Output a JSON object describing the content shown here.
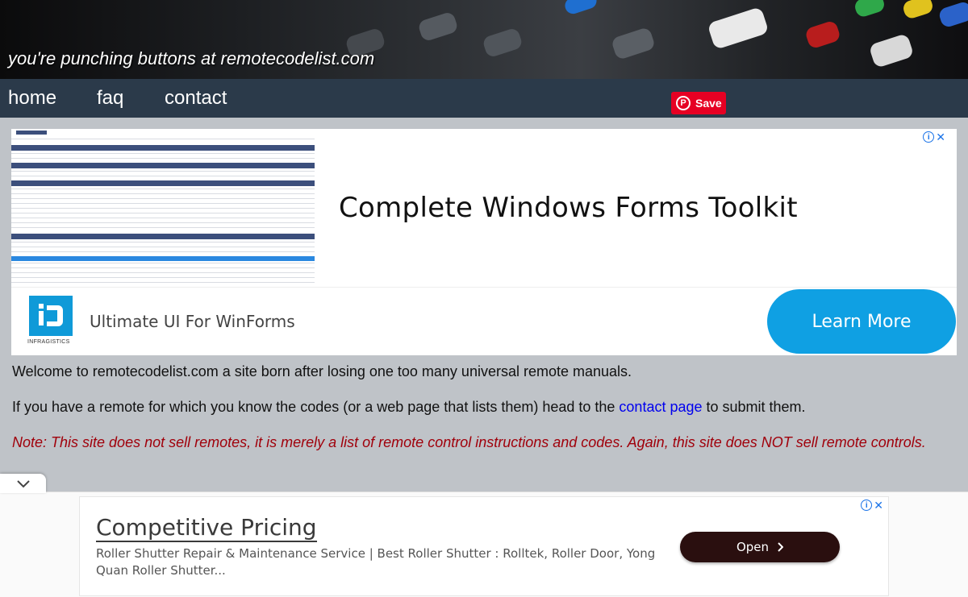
{
  "header": {
    "tagline": "you're punching buttons at remotecodelist.com"
  },
  "nav": {
    "items": [
      "home",
      "faq",
      "contact"
    ]
  },
  "pinterest": {
    "label": "Save",
    "color": "#e60023",
    "icon": "pinterest-icon"
  },
  "top_ad": {
    "headline": "Complete Windows Forms Toolkit",
    "subtitle": "Ultimate UI For WinForms",
    "brand": "INFRAGISTICS",
    "button_label": "Learn More",
    "button_color": "#0fa0e3",
    "info_icon": "info-icon",
    "close_icon": "close-icon"
  },
  "content": {
    "welcome": "Welcome to remotecodelist.com a site born after losing one too many universal remote manuals.",
    "submit_before": "If you have a remote for which you know the codes (or a web page that lists them) head to the ",
    "submit_link": "contact page",
    "submit_after": " to submit them.",
    "note": "Note: This site does not sell remotes, it is merely a list of remote control instructions and codes. Again, this site does NOT sell remote controls."
  },
  "collapse": {
    "icon": "chevron-down-icon"
  },
  "bottom_ad": {
    "title": "Competitive Pricing",
    "description": "Roller Shutter Repair & Maintenance Service | Best Roller Shutter : Rolltek, Roller Door, Yong Quan Roller Shutter...",
    "button_label": "Open",
    "button_color": "#2a0f0f",
    "info_icon": "info-icon",
    "close_icon": "close-icon"
  }
}
